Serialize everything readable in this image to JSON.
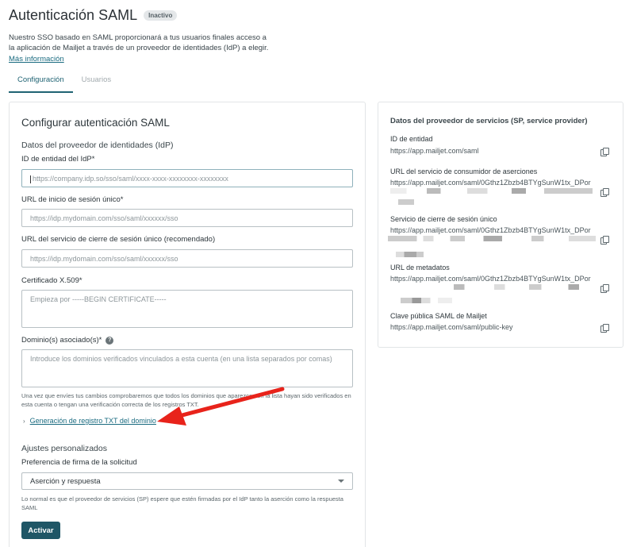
{
  "header": {
    "title": "Autenticación SAML",
    "status_badge": "Inactivo",
    "intro_text": "Nuestro SSO basado en SAML proporcionará a tus usuarios finales acceso a la aplicación de Mailjet a través de un proveedor de identidades (IdP) a elegir. ",
    "more_info_link": "Más información"
  },
  "tabs": [
    {
      "label": "Configuración",
      "active": true
    },
    {
      "label": "Usuarios",
      "active": false
    }
  ],
  "form": {
    "title": "Configurar autenticación SAML",
    "idp_section": "Datos del proveedor de identidades (IdP)",
    "entity_id": {
      "label": "ID de entidad del IdP*",
      "placeholder": "https://company.idp.so/sso/saml/xxxx-xxxx-xxxxxxxx-xxxxxxxx"
    },
    "sso_url": {
      "label": "URL de inicio de sesión único*",
      "placeholder": "https://idp.mydomain.com/sso/saml/xxxxxx/sso"
    },
    "slo_url": {
      "label": "URL del servicio de cierre de sesión único (recomendado)",
      "placeholder": "https://idp.mydomain.com/sso/saml/xxxxxx/sso"
    },
    "certificate": {
      "label": "Certificado X.509*",
      "placeholder": "Empieza por -----BEGIN CERTIFICATE-----"
    },
    "domains": {
      "label": "Dominio(s) asociado(s)*",
      "placeholder": "Introduce los dominios verificados vinculados a esta cuenta (en una lista separados por comas)",
      "help_text": "Una vez que envíes tus cambios comprobaremos que todos los dominios que aparezcan en la lista hayan sido verificados en esta cuenta o tengan una verificación correcta de los registros TXT."
    },
    "txt_link": "Generación de registro TXT del dominio",
    "custom_section": "Ajustes personalizados",
    "signing_pref": {
      "label": "Preferencia de firma de la solicitud",
      "selected": "Aserción y respuesta",
      "help_text": "Lo normal es que el proveedor de servicios (SP) espere que estén firmadas por el IdP tanto la aserción como la respuesta SAML"
    },
    "activate_button": "Activar"
  },
  "sp_panel": {
    "title": "Datos del proveedor de servicios (SP, service provider)",
    "items": [
      {
        "label": "ID de entidad",
        "value": "https://app.mailjet.com/saml"
      },
      {
        "label": "URL del servicio de consumidor de aserciones",
        "value": "https://app.mailjet.com/saml/0Gthz1Zbzb4BTYgSunW1tx_DPor"
      },
      {
        "label": "Servicio de cierre de sesión único",
        "value": "https://app.mailjet.com/saml/0Gthz1Zbzb4BTYgSunW1tx_DPor"
      },
      {
        "label": "URL de metadatos",
        "value": "https://app.mailjet.com/saml/0Gthz1Zbzb4BTYgSunW1tx_DPor"
      },
      {
        "label": "Clave pública SAML de Mailjet",
        "value": "https://app.mailjet.com/saml/public-key"
      }
    ]
  },
  "colors": {
    "accent": "#1f5666",
    "link": "#1a6b80",
    "annotation_arrow": "#e8231b"
  }
}
